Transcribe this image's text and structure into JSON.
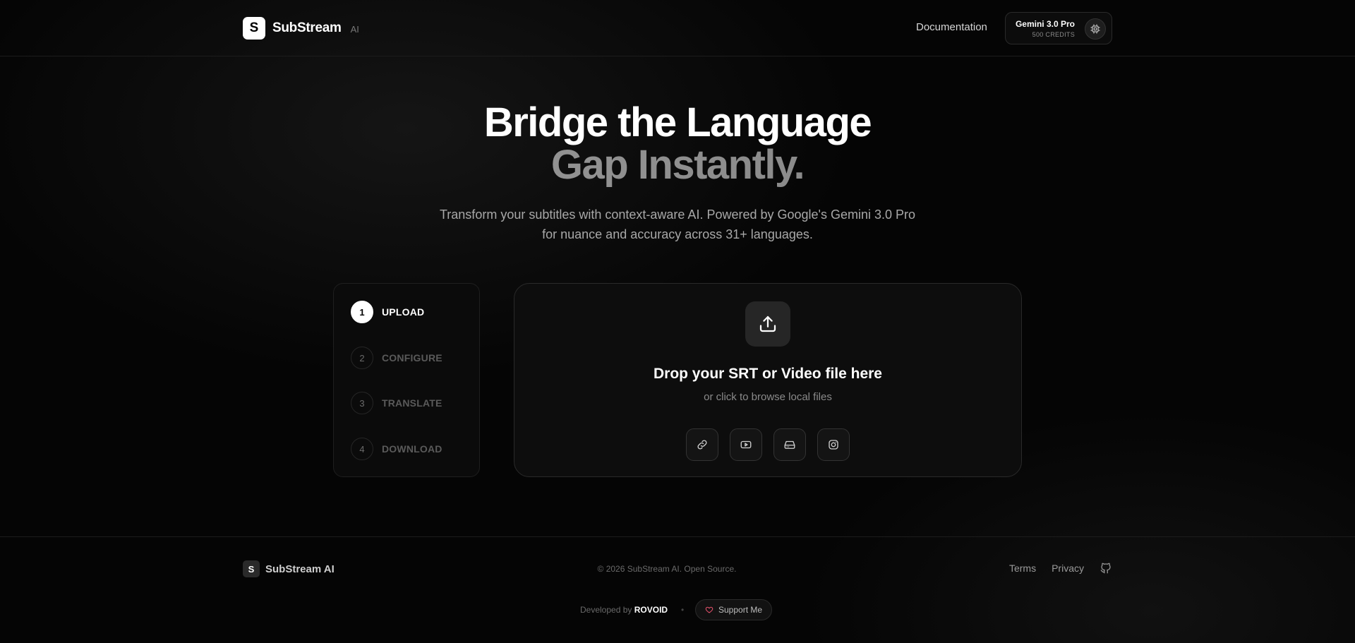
{
  "header": {
    "brand_letter": "S",
    "brand_name": "SubStream",
    "brand_suffix": "AI",
    "nav_documentation": "Documentation",
    "model_name": "Gemini 3.0 Pro",
    "model_credits": "500 CREDITS",
    "model_icon": "chip-icon"
  },
  "hero": {
    "line1": "Bridge the Language",
    "line2": "Gap Instantly.",
    "subtitle": "Transform your subtitles with context-aware AI. Powered by Google's Gemini 3.0 Pro for nuance and accuracy across 31+ languages."
  },
  "steps": [
    {
      "num": "1",
      "label": "UPLOAD",
      "active": true
    },
    {
      "num": "2",
      "label": "CONFIGURE",
      "active": false
    },
    {
      "num": "3",
      "label": "TRANSLATE",
      "active": false
    },
    {
      "num": "4",
      "label": "DOWNLOAD",
      "active": false
    }
  ],
  "dropzone": {
    "icon": "upload-icon",
    "title": "Drop your SRT or Video file here",
    "subtitle": "or click to browse local files",
    "sources": [
      "link-icon",
      "youtube-icon",
      "drive-icon",
      "instagram-icon"
    ]
  },
  "footer": {
    "brand_letter": "S",
    "brand_name": "SubStream AI",
    "copyright": "© 2026 SubStream AI. Open Source.",
    "terms": "Terms",
    "privacy": "Privacy",
    "github_icon": "github-icon",
    "developed_by": "Developed by",
    "developer": "ROVOID",
    "separator": "•",
    "support_label": "Support Me",
    "support_icon": "heart-icon"
  },
  "colors": {
    "background": "#050505",
    "accent": "#ffffff",
    "muted": "#8a8a8a",
    "heart": "#e0506a"
  }
}
